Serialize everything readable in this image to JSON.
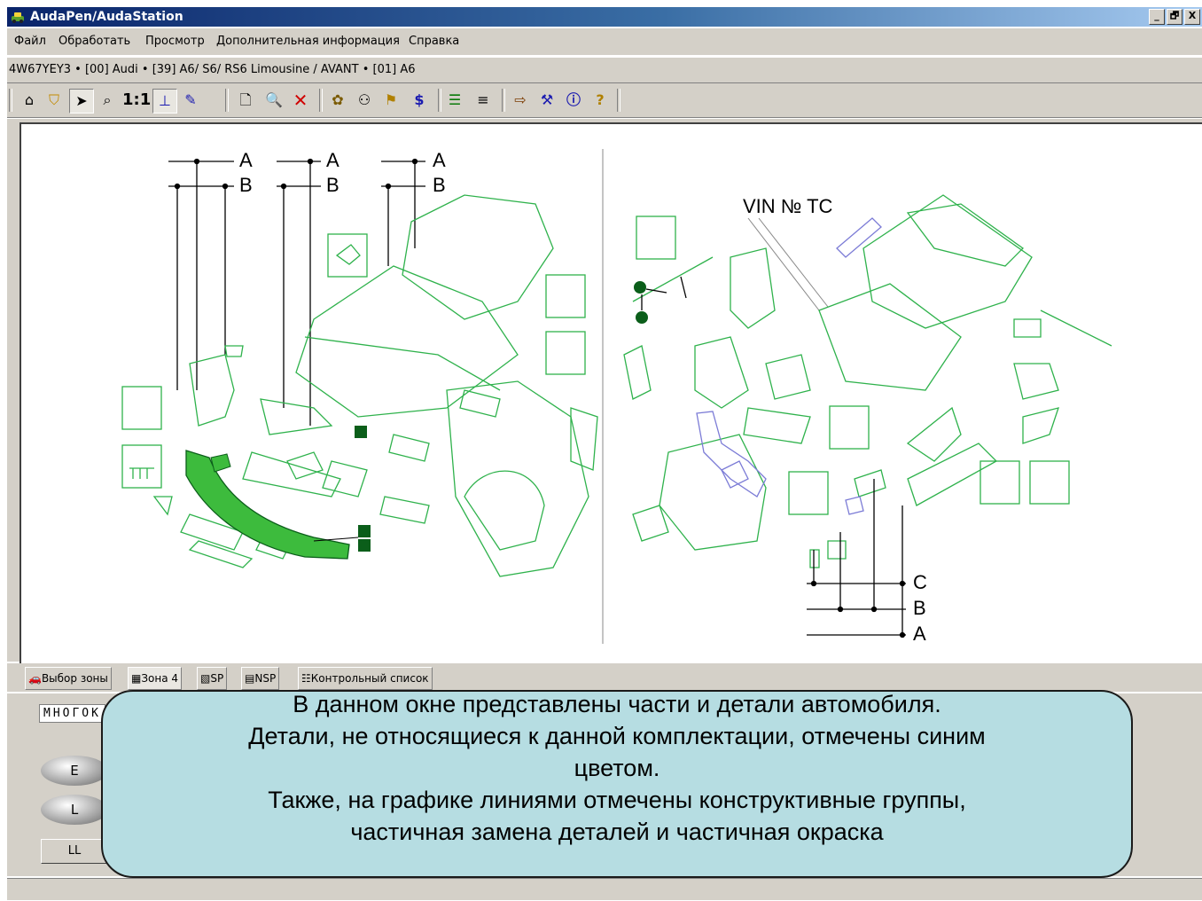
{
  "window": {
    "title": "AudaPen/AudaStation",
    "buttons": [
      "_",
      "🗗",
      "X"
    ]
  },
  "menu": [
    "Файл",
    "Обработать",
    "Просмотр",
    "Дополнительная информация",
    "Справка"
  ],
  "path": {
    "text": "4W67YEY3 • [00] Audi • [39] A6/ S6/ RS6  Limousine / AVANT • [01] A6"
  },
  "toolbar": {
    "icons": [
      "house-up-icon",
      "shield-icon",
      "pointer-icon",
      "zoom-icon",
      "one-to-one-icon",
      "baseline-icon",
      "pen-icon",
      "new-document-icon",
      "search-doc-icon",
      "delete-icon",
      "wheel-icon",
      "people-icon",
      "flag-icon",
      "price-icon",
      "insert-row-icon",
      "remove-row-icon",
      "exit-icon",
      "tools-icon",
      "info-icon",
      "help-icon"
    ],
    "one_to_one": "1:1"
  },
  "drawing": {
    "labels_left": [
      "A",
      "B",
      "A",
      "B",
      "A",
      "B"
    ],
    "vin_label": "VIN № TC",
    "labels_right": [
      "C",
      "B",
      "A"
    ],
    "colors": {
      "part_line": "#2fb24c",
      "part_fill_selected": "#3dbb3d",
      "not_applicable": "#7b7bd6",
      "marker": "#0b5e1a"
    }
  },
  "tabs": [
    {
      "label": "Выбор зоны",
      "icon": "car-icon"
    },
    {
      "label": "Зона 4",
      "icon": "zone-icon"
    },
    {
      "label": "SP",
      "icon": "sp-icon"
    },
    {
      "label": "NSP",
      "icon": "nsp-icon"
    },
    {
      "label": "Контрольный список",
      "icon": "list-icon"
    }
  ],
  "lower": {
    "mnog_label": "МНОГОК",
    "pill_e": "E",
    "pill_l": "L",
    "ll_button": "LL"
  },
  "callout": {
    "lines": [
      "В данном окне представлены части и детали автомобиля.",
      "Детали, не относящиеся к данной комплектации, отмечены синим",
      "цветом.",
      "Также, на графике линиями отмечены конструктивные группы,",
      "частичная замена деталей и частичная окраска"
    ]
  }
}
